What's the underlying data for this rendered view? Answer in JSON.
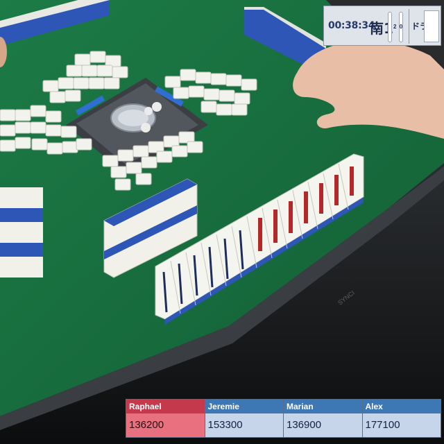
{
  "hud": {
    "time": "00:38:34",
    "round": "南1",
    "honba": "2",
    "riichi": "0",
    "dora_label": "ドラ",
    "dora_icon": "blank-dora-tile"
  },
  "players": [
    {
      "name": "Raphael",
      "score": "136200",
      "active": true
    },
    {
      "name": "Jeremie",
      "score": "153300",
      "active": false
    },
    {
      "name": "Marian",
      "score": "136900",
      "active": false
    },
    {
      "name": "Alex",
      "score": "177100",
      "active": false
    }
  ],
  "colors": {
    "felt": "#1d7a45",
    "table_frame": "#15181a",
    "tile_face": "#f4f4ef",
    "tile_back": "#2f57b8",
    "highlight_player": "#e9707f",
    "player_header": "#3d78b4"
  }
}
